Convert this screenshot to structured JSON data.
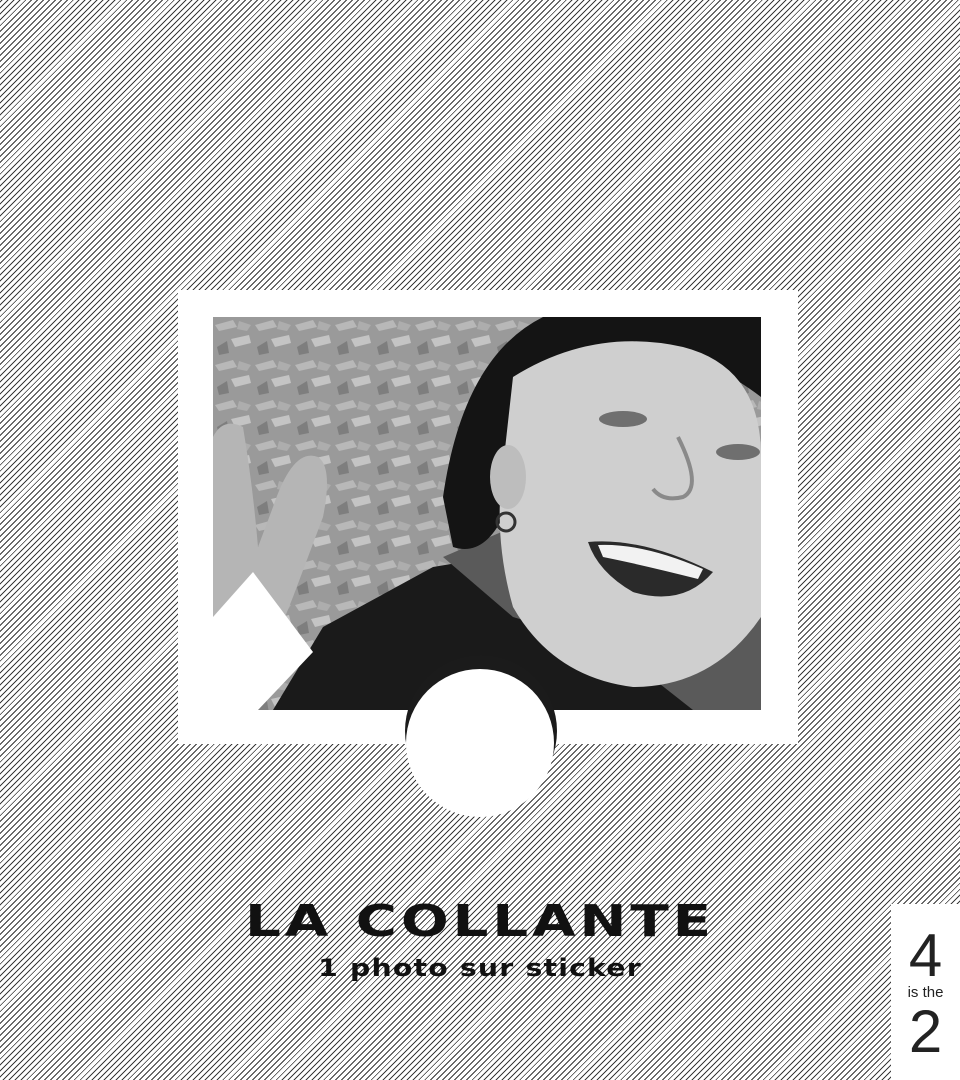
{
  "title": "LA COLLANTE",
  "subtitle": "1 photo sur sticker",
  "logo": {
    "top": "4",
    "middle": "is the",
    "bottom": "2"
  },
  "photo": {
    "icon": "portrait-photo"
  },
  "colors": {
    "background_lines": "#3a3a3a",
    "frame": "#ffffff",
    "text": "#111111"
  }
}
